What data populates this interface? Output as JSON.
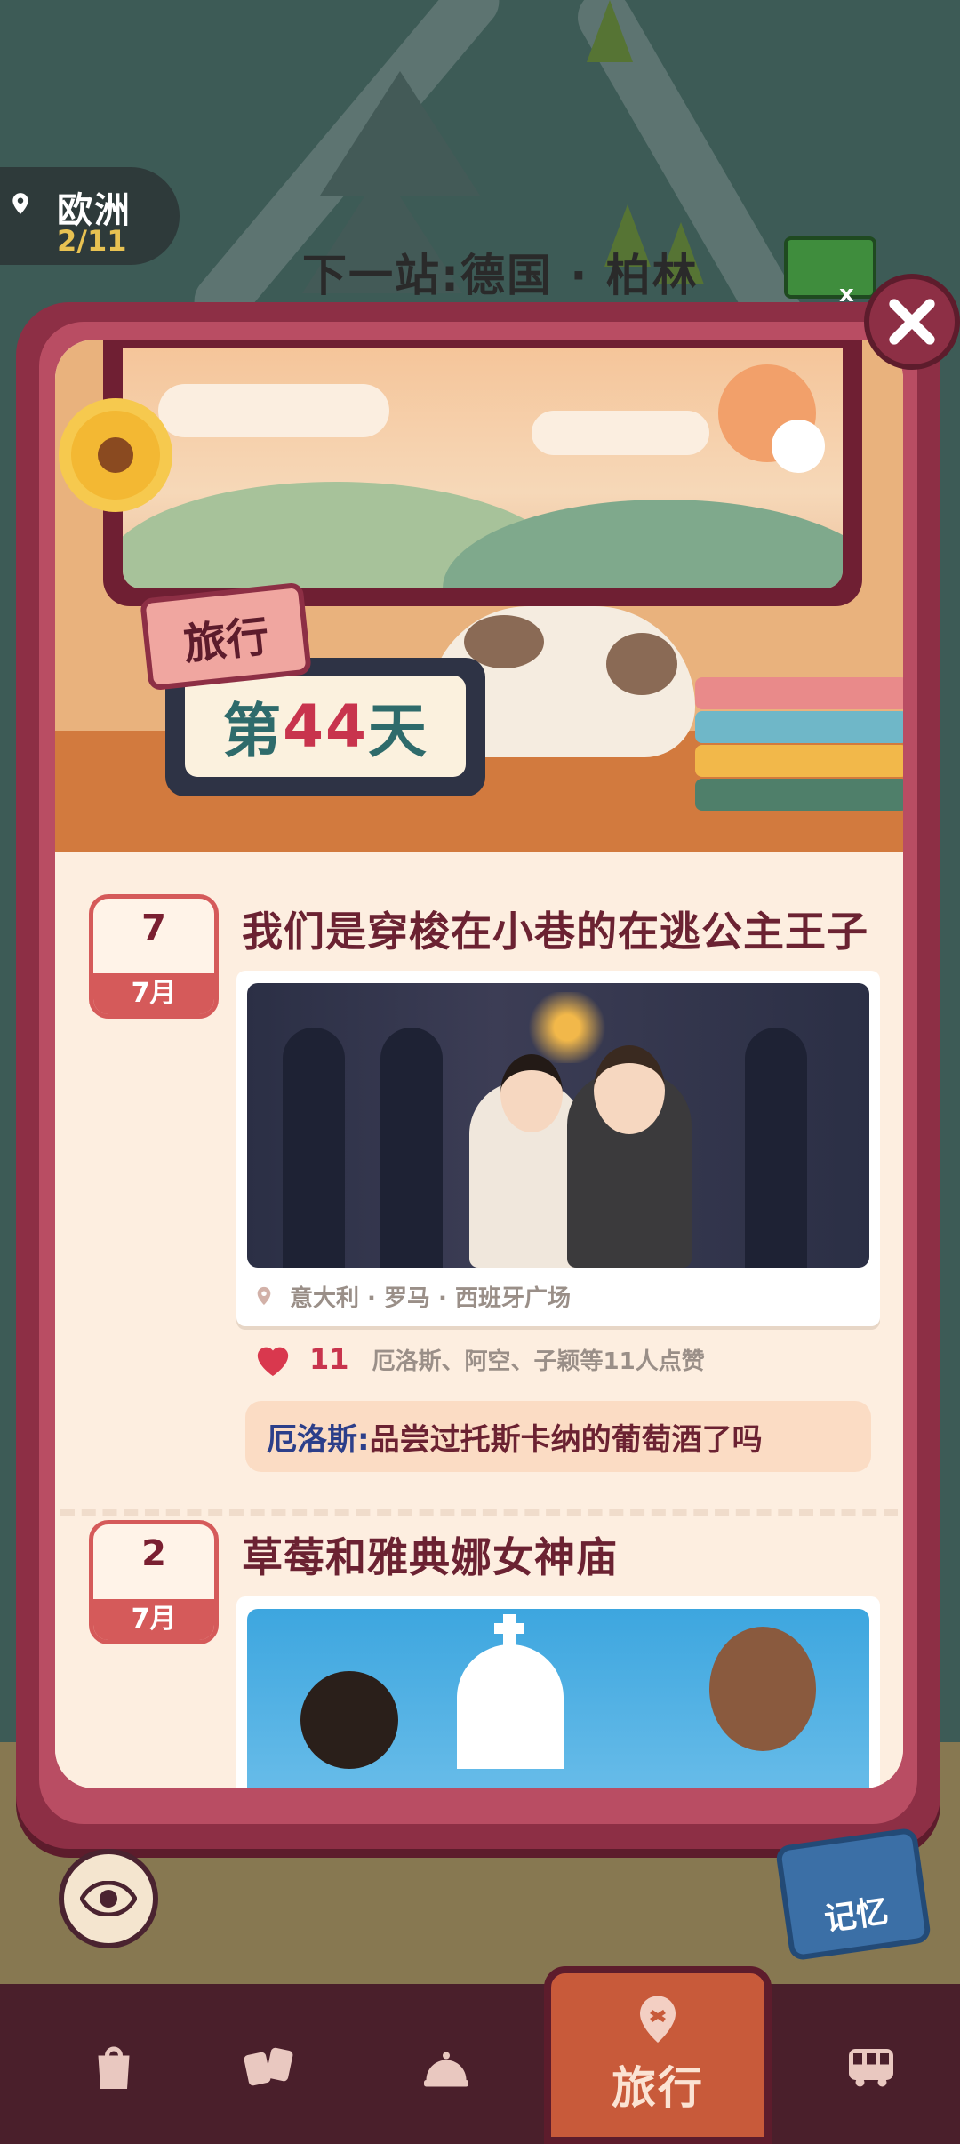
{
  "region": {
    "name": "欧洲",
    "progress": "2/11"
  },
  "next_stop": "下一站:德国 · 柏林",
  "currency": {
    "count": "x"
  },
  "header": {
    "tag": "旅行",
    "day_prefix": "第",
    "day_number": "44",
    "day_suffix": "天"
  },
  "entries": [
    {
      "day": "7",
      "month": "7月",
      "title": "我们是穿梭在小巷的在逃公主王子",
      "location": "意大利 · 罗马 · 西班牙广场",
      "like_count": "11",
      "likers": "厄洛斯、阿空、子颖等11人点赞",
      "comment_author": "厄洛斯:",
      "comment_text": " 品尝过托斯卡纳的葡萄酒了吗"
    },
    {
      "day": "2",
      "month": "7月",
      "title": "草莓和雅典娜女神庙"
    }
  ],
  "memory_label": "记忆",
  "nav": [
    {
      "icon": "bag-icon"
    },
    {
      "icon": "cards-icon"
    },
    {
      "icon": "service-bell-icon"
    },
    {
      "icon": "map-pin-icon",
      "label": "旅行",
      "active": true
    },
    {
      "icon": "bus-icon"
    }
  ],
  "colors": {
    "panel": "#8d2f45",
    "accent_red": "#c8344d",
    "title_text": "#6b2232",
    "nav_bg": "#4a1f2b",
    "active_tab": "#c85a3a"
  }
}
